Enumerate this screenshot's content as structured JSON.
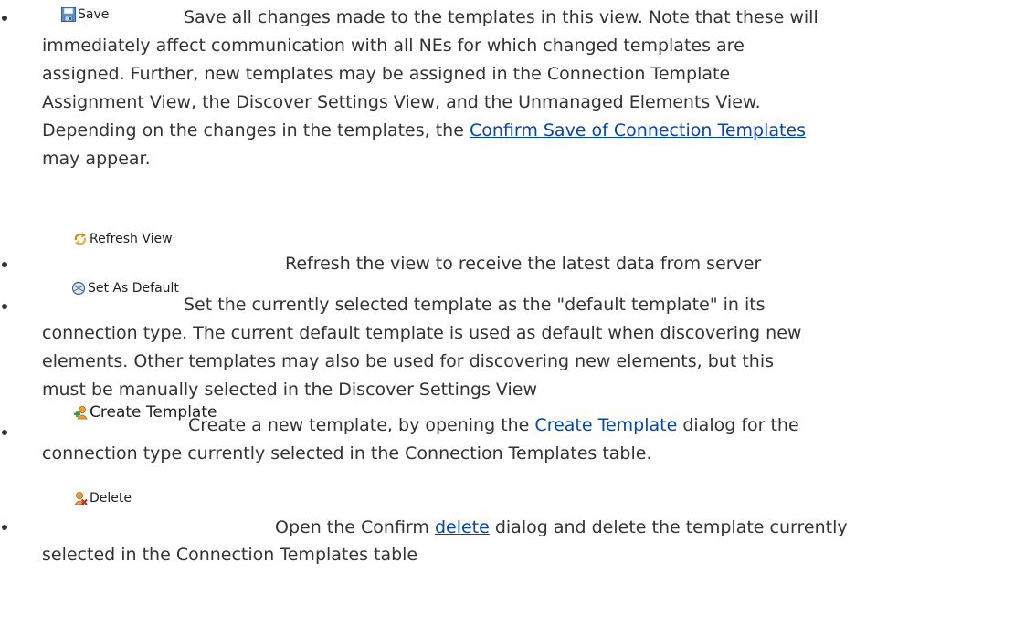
{
  "colors": {
    "text": "#333333",
    "link": "#0645ad"
  },
  "items": [
    {
      "tool": {
        "label": "Save",
        "icon": "floppy-disk-icon"
      },
      "first_line": "Save all changes made to the templates in this view. Note that these will",
      "line2": "immediately affect communication with all NEs for which changed templates are",
      "line3": "assigned. Further, new templates may be assigned in the Connection Template",
      "line4": "Assignment View, the Discover Settings View, and the Unmanaged Elements View.",
      "line5_pre": "Depending on the changes in the templates, the ",
      "line5_link": "Confirm Save of Connection Templates",
      "line6": "may appear."
    },
    {
      "tool": {
        "label": "Refresh View",
        "icon": "refresh-arrows-icon"
      },
      "first_line": "Refresh the view to receive the latest data from server"
    },
    {
      "tool": {
        "label": "Set As Default",
        "icon": "default-globe-icon"
      },
      "first_line": "Set the currently selected template as the \"default template\" in its",
      "line2": "connection type. The current default template is used as default when discovering new",
      "line3": "elements. Other templates may also be used for discovering new elements, but this",
      "line4": "must be manually selected in the Discover Settings View"
    },
    {
      "tool": {
        "label": "Create Template",
        "icon": "create-template-icon"
      },
      "first_line_pre": "Create a new template, by opening the ",
      "first_line_link": "Create Template",
      "first_line_post": " dialog for the",
      "line2": "connection type currently selected in the Connection Templates table."
    },
    {
      "tool": {
        "label": "Delete",
        "icon": "delete-template-icon"
      },
      "first_line_pre": "Open the Confirm ",
      "first_line_link": "delete",
      "first_line_post": " dialog and delete the template currently",
      "line2": "selected in the Connection Templates table"
    }
  ]
}
